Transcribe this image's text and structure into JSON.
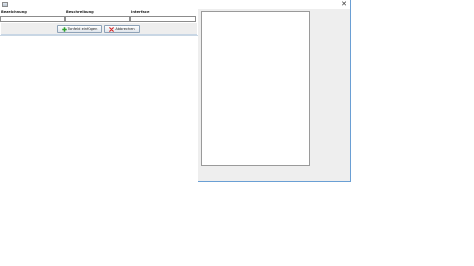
{
  "window": {
    "close_glyph": "✕",
    "app_icon": "app-window-icon"
  },
  "form": {
    "fields": [
      {
        "label": "Bezeichnung",
        "value": ""
      },
      {
        "label": "Beschreibung",
        "value": ""
      },
      {
        "label": "Interface",
        "value": ""
      }
    ]
  },
  "buttons": {
    "add": {
      "label": "Tonfeld einfügen",
      "icon": "plus-icon",
      "icon_color": "#2fa12f"
    },
    "cancel": {
      "label": "Abbrechen",
      "icon": "x-icon",
      "icon_color": "#d42a2a"
    }
  },
  "colors": {
    "accent_border": "#6a9fd4",
    "panel_bg": "#eeeeee"
  }
}
